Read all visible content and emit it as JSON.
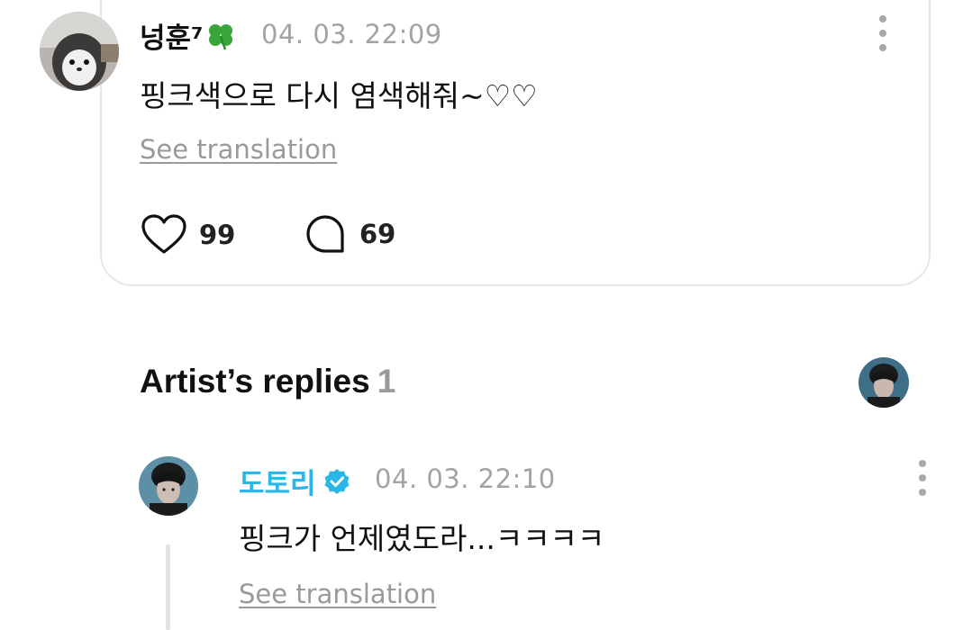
{
  "comment": {
    "username": "넝훈⁷",
    "badge_emoji": "four-leaf-clover",
    "timestamp": "04. 03. 22:09",
    "text": "핑크색으로 다시 염색해줘~♡♡",
    "see_translation": "See translation",
    "likes": "99",
    "replies": "69"
  },
  "artist_replies": {
    "title": "Artist’s replies",
    "count": "1",
    "reply": {
      "username": "도토리",
      "verified": true,
      "timestamp": "04. 03. 22:10",
      "text": "핑크가 언제였도라...ㅋㅋㅋㅋ",
      "see_translation": "See translation"
    }
  },
  "colors": {
    "artist_name": "#2ab6e6",
    "muted_text": "#a3a3a3",
    "card_border": "#e6e6e6"
  },
  "icons": [
    "more-vertical-icon",
    "heart-icon",
    "comment-bubble-icon",
    "verified-badge-icon",
    "clover-icon"
  ]
}
